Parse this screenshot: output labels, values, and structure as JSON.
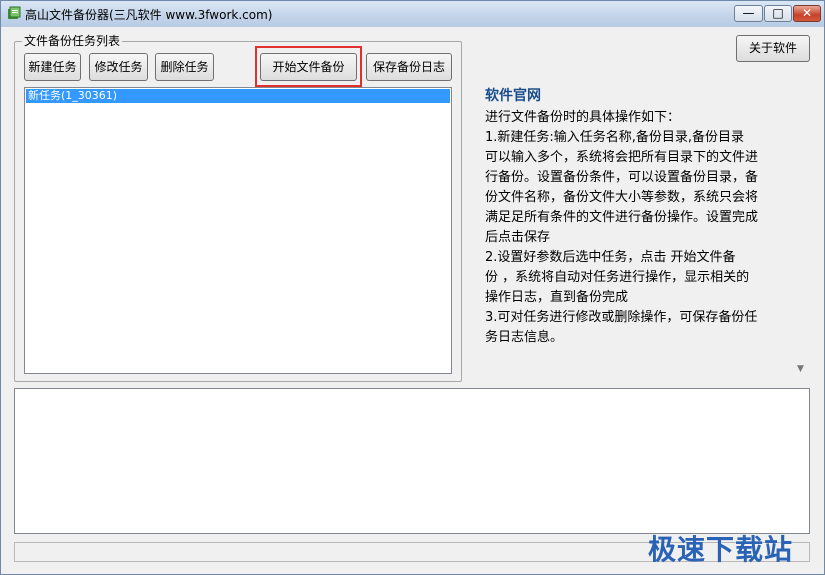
{
  "window": {
    "title": "高山文件备份器(三凡软件 www.3fwork.com)",
    "min_glyph": "—",
    "max_glyph": "□",
    "close_glyph": "✕"
  },
  "taskgroup": {
    "label": "文件备份任务列表"
  },
  "toolbar": {
    "new_task": "新建任务",
    "edit_task": "修改任务",
    "delete_task": "删除任务",
    "start_backup": "开始文件备份",
    "save_log": "保存备份日志",
    "about": "关于软件"
  },
  "tasks": [
    {
      "label": "新任务(1_30361)",
      "selected": true
    }
  ],
  "info": {
    "title": "软件官网",
    "lines": [
      "进行文件备份时的具体操作如下：",
      "1.新建任务:输入任务名称,备份目录,备份目录",
      "可以输入多个，系统将会把所有目录下的文件进",
      "行备份。设置备份条件，可以设置备份目录，备",
      "份文件名称，备份文件大小等参数，系统只会将",
      "满足足所有条件的文件进行备份操作。设置完成",
      "后点击保存",
      "2.设置好参数后选中任务，点击 开始文件备",
      "份 ，系统将自动对任务进行操作，显示相关的",
      "操作日志，直到备份完成",
      "3.可对任务进行修改或删除操作，可保存备份任",
      "务日志信息。"
    ]
  },
  "watermark": "极速下载站",
  "colors": {
    "selection": "#3399ff",
    "highlight_border": "#e03030",
    "info_title": "#1a4d8c",
    "watermark": "#2a62b5"
  }
}
